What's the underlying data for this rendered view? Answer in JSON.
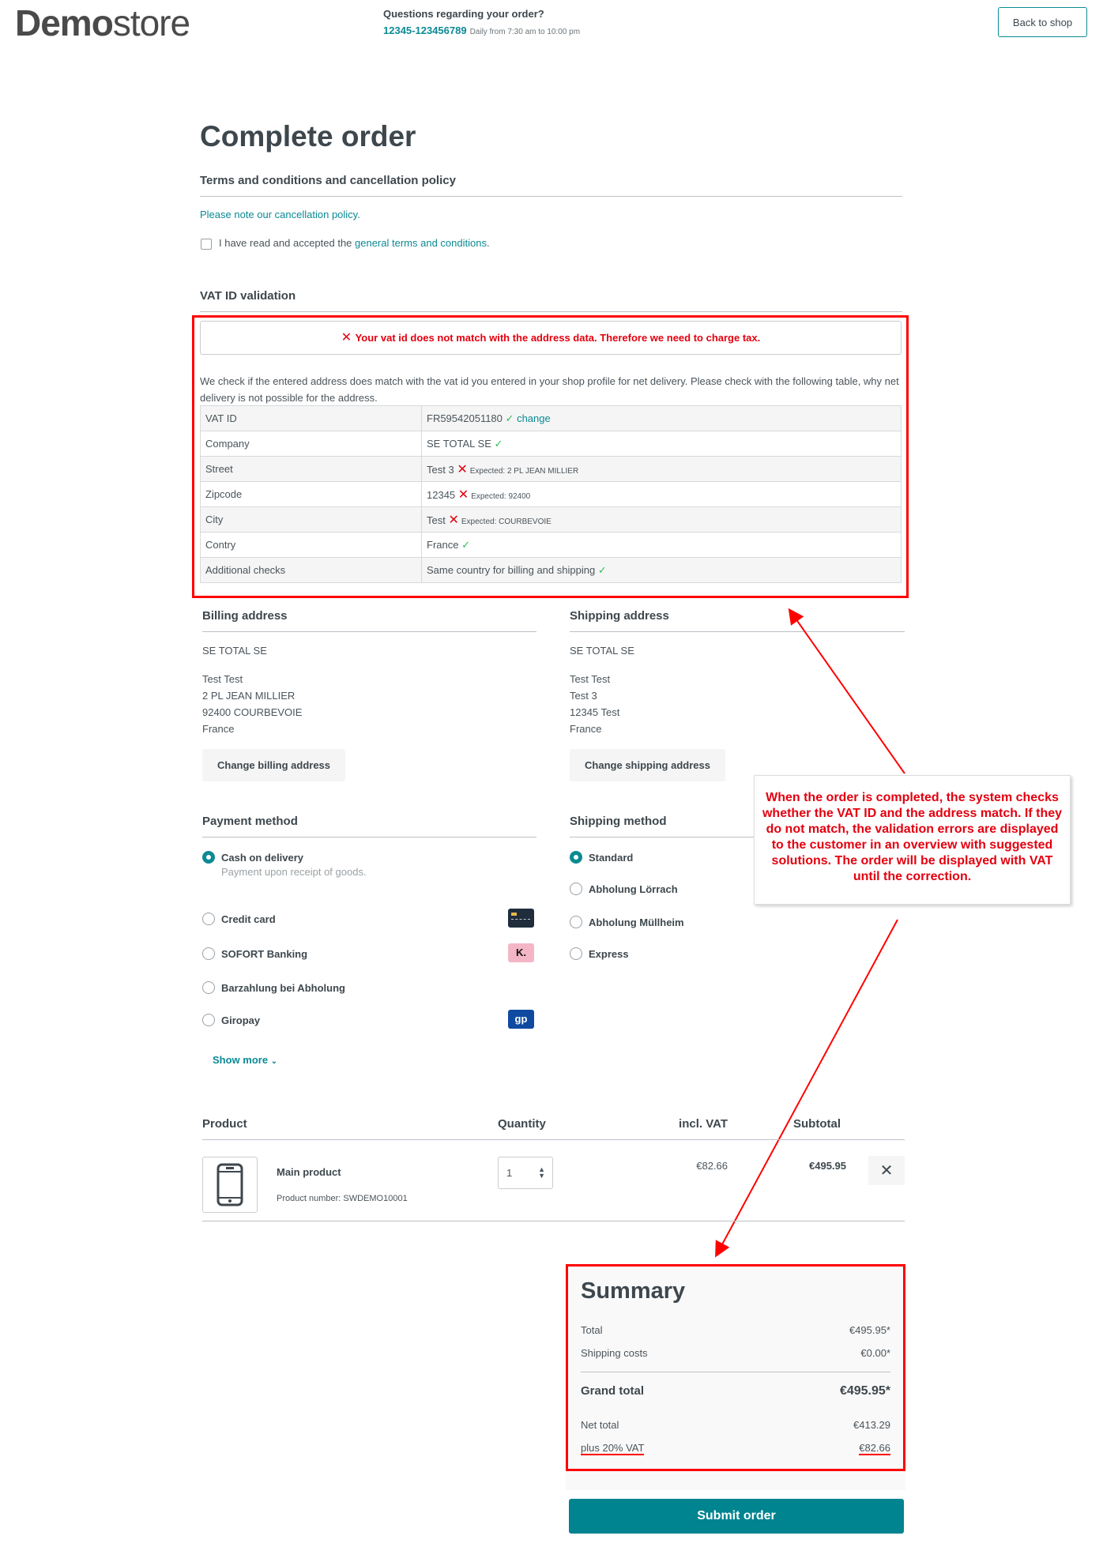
{
  "header": {
    "logo_bold": "Demo",
    "logo_light": "store",
    "question": "Questions regarding your order?",
    "phone": "12345-123456789",
    "hours": "Daily from 7:30 am to 10:00 pm",
    "back_label": "Back to shop"
  },
  "page_title": "Complete order",
  "terms": {
    "heading": "Terms and conditions and cancellation policy",
    "note_link": "Please note our cancellation policy.",
    "checkbox_prefix": "I have read and accepted the ",
    "checkbox_link": "general terms and conditions",
    "checkbox_suffix": ".",
    "checked": false
  },
  "vat": {
    "heading": "VAT ID validation",
    "alert": "Your vat id does not match with the address data. Therefore we need to charge tax.",
    "description": "We check if the entered address does match with the vat id you entered in your shop profile for net delivery. Please check with the following table, why net delivery is not possible for the address.",
    "rows": [
      {
        "label": "VAT ID",
        "value": "FR59542051180",
        "status": "ok",
        "link": "change",
        "expected": ""
      },
      {
        "label": "Company",
        "value": "SE TOTAL SE",
        "status": "ok",
        "expected": ""
      },
      {
        "label": "Street",
        "value": "Test 3",
        "status": "error",
        "expected": "Expected: 2 PL JEAN MILLIER"
      },
      {
        "label": "Zipcode",
        "value": "12345",
        "status": "error",
        "expected": "Expected: 92400"
      },
      {
        "label": "City",
        "value": "Test",
        "status": "error",
        "expected": "Expected: COURBEVOIE"
      },
      {
        "label": "Contry",
        "value": "France",
        "status": "ok",
        "expected": ""
      },
      {
        "label": "Additional checks",
        "value": "Same country for billing and shipping",
        "status": "ok",
        "expected": ""
      }
    ]
  },
  "billing": {
    "heading": "Billing address",
    "company": "SE TOTAL SE",
    "lines": [
      "Test Test",
      "2 PL JEAN MILLIER",
      "92400 COURBEVOIE",
      "France"
    ],
    "button": "Change billing address"
  },
  "shipping": {
    "heading": "Shipping address",
    "company": "SE TOTAL SE",
    "lines": [
      "Test Test",
      "Test 3",
      "12345 Test",
      "France"
    ],
    "button": "Change shipping address"
  },
  "payment": {
    "heading": "Payment method",
    "options": [
      {
        "label": "Cash on delivery",
        "selected": true,
        "description": "Payment upon receipt of goods."
      },
      {
        "label": "Credit card",
        "selected": false,
        "icon": "credit-card-icon"
      },
      {
        "label": "SOFORT Banking",
        "selected": false,
        "icon": "klarna-icon",
        "icon_text": "K."
      },
      {
        "label": "Barzahlung bei Abholung",
        "selected": false
      },
      {
        "label": "Giropay",
        "selected": false,
        "icon": "giropay-icon",
        "icon_text": "gp"
      }
    ],
    "show_more": "Show more"
  },
  "shipping_method": {
    "heading": "Shipping method",
    "options": [
      {
        "label": "Standard",
        "selected": true
      },
      {
        "label": "Abholung Lörrach",
        "selected": false
      },
      {
        "label": "Abholung Müllheim",
        "selected": false
      },
      {
        "label": "Express",
        "selected": false
      }
    ]
  },
  "annotation": "When the order is completed, the system checks whether the VAT ID and the address match. If they do not match, the validation errors are displayed to the customer in an overview with suggested solutions. The order will be displayed with VAT until the correction.",
  "cart": {
    "headers": {
      "product": "Product",
      "quantity": "Quantity",
      "vat": "incl. VAT",
      "subtotal": "Subtotal"
    },
    "items": [
      {
        "name": "Main product",
        "number": "Product number: SWDEMO10001",
        "quantity": "1",
        "vat": "€82.66",
        "subtotal": "€495.95"
      }
    ]
  },
  "summary": {
    "title": "Summary",
    "total_label": "Total",
    "total": "€495.95*",
    "shipping_label": "Shipping costs",
    "shipping": "€0.00*",
    "grand_label": "Grand total",
    "grand": "€495.95*",
    "net_label": "Net total",
    "net": "€413.29",
    "vat_label": "plus 20% VAT",
    "vat": "€82.66"
  },
  "submit_label": "Submit order",
  "colors": {
    "accent": "#008490",
    "error": "#e3000f",
    "success": "#2ebd59",
    "annotation": "#ff0000"
  }
}
